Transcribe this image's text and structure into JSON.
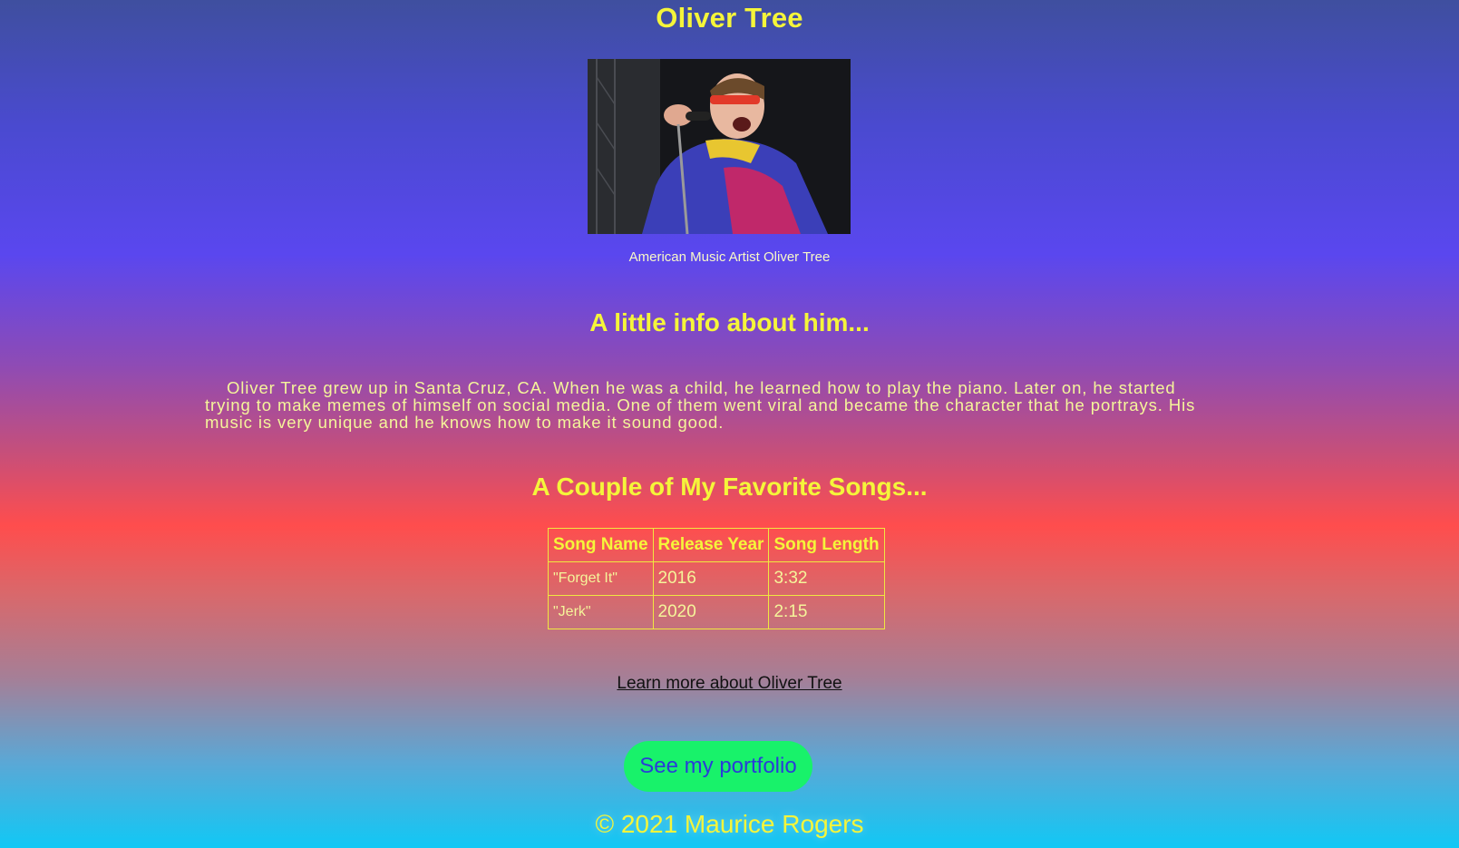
{
  "header": {
    "title": "Oliver Tree"
  },
  "hero": {
    "image_icon": "artist-photo",
    "caption": "American Music Artist Oliver Tree"
  },
  "info": {
    "heading": "A little info about him...",
    "bio": "Oliver Tree grew up in Santa Cruz, CA. When he was a child, he learned how to play the piano. Later on, he started trying to make memes of himself on social media. One of them went viral and became the character that he portrays. His music is very unique and he knows how to make it sound good."
  },
  "songs": {
    "heading": "A Couple of My Favorite Songs...",
    "columns": [
      "Song Name",
      "Release Year",
      "Song Length"
    ],
    "rows": [
      [
        "\"Forget It\"",
        "2016",
        "3:32"
      ],
      [
        "\"Jerk\"",
        "2020",
        "2:15"
      ]
    ]
  },
  "links": {
    "learn_more": "Learn more about Oliver Tree",
    "portfolio_button": "See my portfolio"
  },
  "footer": {
    "copyright": "© 2021 Maurice Rogers"
  },
  "colors": {
    "heading": "#f5f53a",
    "button_bg": "#18f26a",
    "button_text": "#2a3cd8"
  }
}
